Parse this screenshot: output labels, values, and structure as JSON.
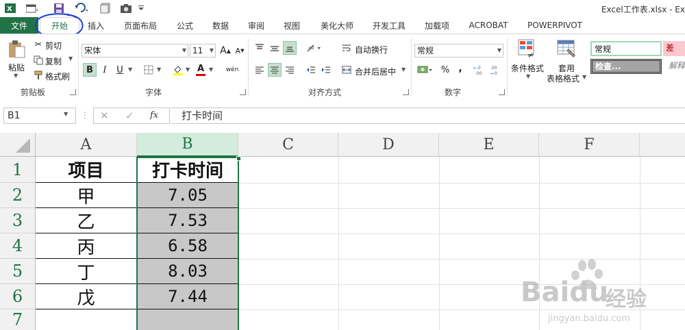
{
  "window": {
    "title": "Excel工作表.xlsx - Ex"
  },
  "tabs": {
    "file": "文件",
    "home": "开始",
    "items": [
      "插入",
      "页面布局",
      "公式",
      "数据",
      "审阅",
      "视图",
      "美化大师",
      "开发工具",
      "加载项",
      "ACROBAT",
      "POWERPIVOT"
    ]
  },
  "ribbon": {
    "clipboard": {
      "label": "剪贴板",
      "paste": "粘贴",
      "cut": "剪切",
      "copy": "复制",
      "format_painter": "格式刷"
    },
    "font": {
      "label": "字体",
      "name": "宋体",
      "size": "11",
      "grow": "A",
      "shrink": "A",
      "bold": "B",
      "italic": "I",
      "underline": "U",
      "font_color_glyph": "A",
      "phonetic_glyph": "wén"
    },
    "alignment": {
      "label": "对齐方式",
      "wrap_text": "自动换行",
      "merge_center": "合并后居中"
    },
    "number": {
      "label": "数字",
      "format": "常规",
      "percent": "%",
      "comma": ","
    },
    "styles": {
      "conditional_format": "条件格式",
      "format_table_line1": "套用",
      "format_table_line2": "表格格式",
      "gallery": [
        "常规",
        "差",
        "检查...",
        "解释"
      ]
    }
  },
  "formula_bar": {
    "name_box": "B1",
    "fx": "fx",
    "content": "打卡时间"
  },
  "sheet": {
    "columns": [
      "A",
      "B",
      "C",
      "D",
      "E",
      "F"
    ],
    "rows": [
      "1",
      "2",
      "3",
      "4",
      "5",
      "6",
      "7"
    ],
    "header": [
      "项目",
      "打卡时间"
    ],
    "data": [
      [
        "甲",
        "7.05"
      ],
      [
        "乙",
        "7.53"
      ],
      [
        "丙",
        "6.58"
      ],
      [
        "丁",
        "8.03"
      ],
      [
        "戊",
        "7.44"
      ]
    ],
    "selected_column": "B",
    "accent": "#217346",
    "selection_fill": "#c8c8c8"
  },
  "watermark": {
    "brand": "Baidu",
    "product": "经验",
    "url": "jingyan.baidu.com"
  }
}
